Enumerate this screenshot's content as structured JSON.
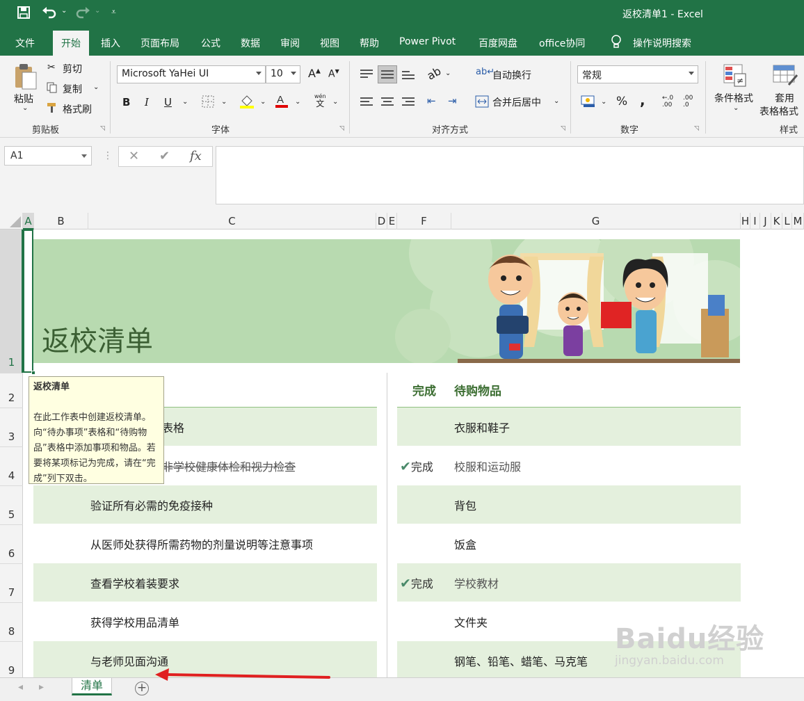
{
  "titlebar": {
    "title": "返校清单1  -  Excel"
  },
  "menu": {
    "tabs": [
      "文件",
      "开始",
      "插入",
      "页面布局",
      "公式",
      "数据",
      "审阅",
      "视图",
      "帮助",
      "Power Pivot",
      "百度网盘",
      "office协同"
    ],
    "search": "操作说明搜索"
  },
  "ribbon": {
    "clipboard": {
      "paste": "粘贴",
      "cut": "剪切",
      "copy": "复制",
      "format_painter": "格式刷",
      "label": "剪贴板"
    },
    "font": {
      "name": "Microsoft YaHei UI",
      "size": "10",
      "bold": "B",
      "italic": "I",
      "underline": "U",
      "label": "字体",
      "pinyin_top": "wén",
      "pinyin_bottom": "文"
    },
    "alignment": {
      "wrap": "自动换行",
      "merge": "合并后居中",
      "label": "对齐方式"
    },
    "number": {
      "format": "常规",
      "percent": "%",
      "comma": ",",
      "inc_decimal": ".00",
      "dec_decimal": ".0",
      "label": "数字"
    },
    "styles": {
      "conditional": "条件格式",
      "table_line1": "套用",
      "table_line2": "表格格式",
      "label": "样式"
    }
  },
  "formula_bar": {
    "name_box": "A1",
    "cancel": "✕",
    "enter": "✔",
    "fx": "fx",
    "value": ""
  },
  "columns": [
    "A",
    "B",
    "C",
    "D",
    "E",
    "F",
    "G",
    "H",
    "I",
    "J",
    "K",
    "L",
    "M"
  ],
  "rows": [
    "1",
    "2",
    "3",
    "4",
    "5",
    "6",
    "7",
    "8",
    "9"
  ],
  "sheet": {
    "banner_title": "返校清单",
    "todo": [
      {
        "text": "表格",
        "strike": false
      },
      {
        "text": "非学校健康体检和视力检查",
        "strike": true
      },
      {
        "text": "验证所有必需的免疫接种",
        "strike": false
      },
      {
        "text": "从医师处获得所需药物的剂量说明等注意事项",
        "strike": false
      },
      {
        "text": "查看学校着装要求",
        "strike": false
      },
      {
        "text": "获得学校用品清单",
        "strike": false
      },
      {
        "text": "与老师见面沟通",
        "strike": false
      }
    ],
    "shopping": {
      "header_done": "完成",
      "header_item": "待购物品",
      "items": [
        {
          "done": "",
          "item": "衣服和鞋子"
        },
        {
          "done": "完成",
          "item": "校服和运动服"
        },
        {
          "done": "",
          "item": "背包"
        },
        {
          "done": "",
          "item": "饭盒"
        },
        {
          "done": "完成",
          "item": "学校教材"
        },
        {
          "done": "",
          "item": "文件夹"
        },
        {
          "done": "",
          "item": "钢笔、铅笔、蜡笔、马克笔"
        }
      ]
    }
  },
  "tooltip": {
    "title": "返校清单",
    "body": "在此工作表中创建返校清单。向“待办事项”表格和“待购物品”表格中添加事项和物品。若要将某项标记为完成，请在“完成”列下双击。"
  },
  "sheet_tabs": {
    "active": "清单",
    "add": "+"
  },
  "watermark": {
    "brand": "Baidu经验",
    "url": "jingyan.baidu.com"
  },
  "colors": {
    "excel_green": "#217346",
    "banner": "#b8dab0",
    "row_fill": "#e4f0dd",
    "header_text": "#3c6e32",
    "annotation_arrow": "#e02020"
  }
}
